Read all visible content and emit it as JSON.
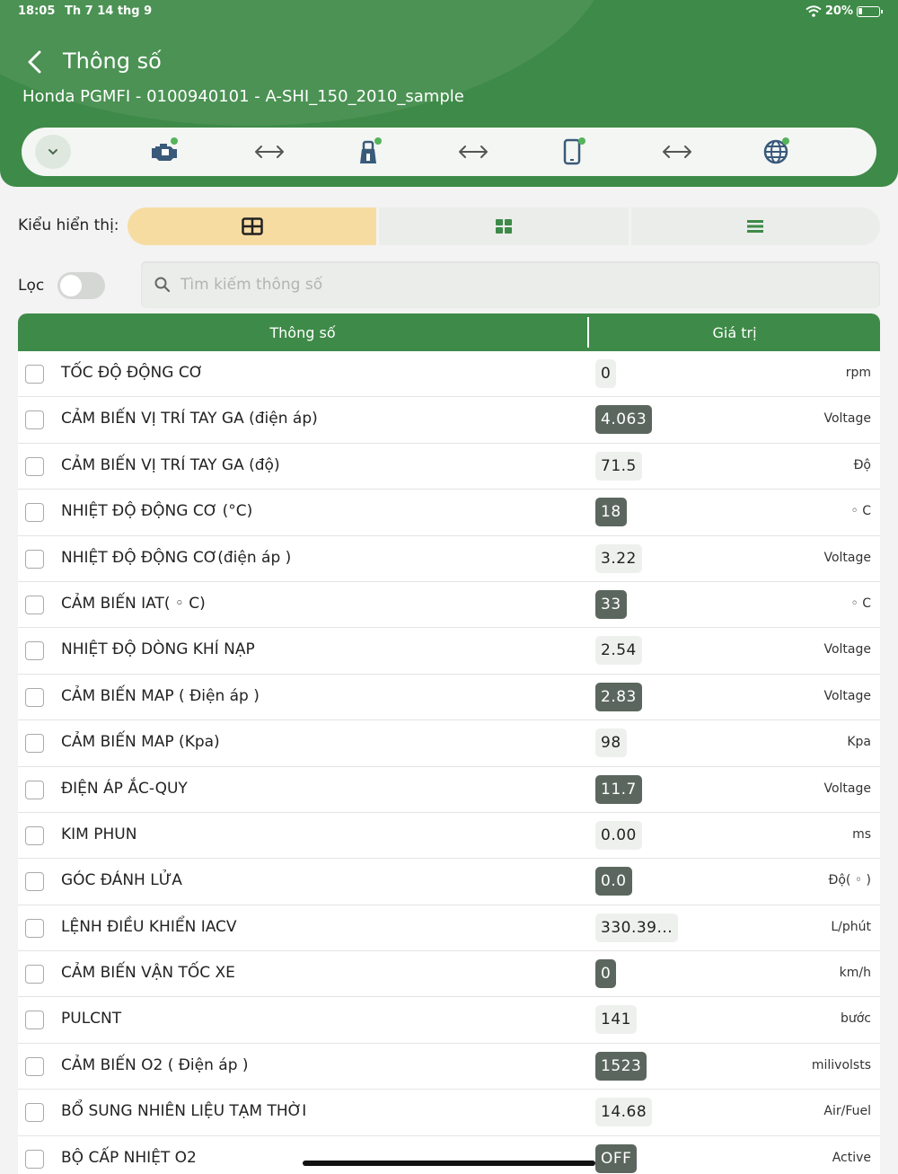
{
  "status": {
    "time": "18:05",
    "date": "Th 7 14 thg 9",
    "battery": "20%"
  },
  "header": {
    "title": "Thông số",
    "subtitle": "Honda PGMFI - 0100940101 - A-SHI_150_2010_sample"
  },
  "connection_icons": [
    "chevron-down-icon",
    "engine-icon",
    "left-right-arrow-icon",
    "obd-adapter-icon",
    "left-right-arrow-icon",
    "phone-icon",
    "left-right-arrow-icon",
    "globe-icon"
  ],
  "display": {
    "label": "Kiểu hiển thị:",
    "modes": [
      "table-icon",
      "grid-icon",
      "list-icon"
    ],
    "active": 0
  },
  "filter": {
    "label": "Lọc",
    "enabled": false
  },
  "search": {
    "placeholder": "Tìm kiếm thông số",
    "value": ""
  },
  "table": {
    "headers": {
      "param": "Thông số",
      "value": "Giá trị"
    },
    "rows": [
      {
        "name": "TỐC ĐỘ ĐỘNG CƠ",
        "value": "0",
        "unit": "rpm",
        "dark": false
      },
      {
        "name": "CẢM BIẾN  VỊ TRÍ TAY GA (điện áp)",
        "value": "4.063",
        "unit": "Voltage",
        "dark": true
      },
      {
        "name": "CẢM BIẾN  VỊ TRÍ TAY GA (độ)",
        "value": "71.5",
        "unit": "Độ",
        "dark": false
      },
      {
        "name": "NHIỆT ĐỘ ĐỘNG CƠ (°C)",
        "value": "18",
        "unit": "◦ C",
        "dark": true
      },
      {
        "name": "NHIỆT ĐỘ ĐỘNG CƠ(điện áp )",
        "value": "3.22",
        "unit": "Voltage",
        "dark": false
      },
      {
        "name": "CẢM BIẾN IAT(  ◦ C)",
        "value": "33",
        "unit": "◦ C",
        "dark": true
      },
      {
        "name": "NHIỆT ĐỘ DÒNG KHÍ NẠP",
        "value": "2.54",
        "unit": "Voltage",
        "dark": false
      },
      {
        "name": "CẢM BIẾN MAP ( Điện áp )",
        "value": "2.83",
        "unit": "Voltage",
        "dark": true
      },
      {
        "name": "CẢM BIẾN MAP (Kpa)",
        "value": "98",
        "unit": "Kpa",
        "dark": false
      },
      {
        "name": "ĐIỆN ÁP ẮC-QUY",
        "value": "11.7",
        "unit": "Voltage",
        "dark": true
      },
      {
        "name": "KIM PHUN",
        "value": "0.00",
        "unit": "ms",
        "dark": false
      },
      {
        "name": "GÓC ĐÁNH LỬA",
        "value": "0.0",
        "unit": "Độ( ◦ )",
        "dark": true
      },
      {
        "name": "LỆNH ĐIỀU KHIỂN IACV",
        "value": "330.39...",
        "unit": "L/phút",
        "dark": false
      },
      {
        "name": "CẢM BIẾN VẬN TỐC XE",
        "value": "0",
        "unit": "km/h",
        "dark": true
      },
      {
        "name": "PULCNT",
        "value": "141",
        "unit": "bước",
        "dark": false
      },
      {
        "name": "CẢM BIẾN O2 ( Điện áp )",
        "value": "1523",
        "unit": "milivolsts",
        "dark": true
      },
      {
        "name": "BỔ SUNG NHIÊN LIỆU TẠM THỜI",
        "value": "14.68",
        "unit": "Air/Fuel",
        "dark": false
      },
      {
        "name": "BỘ CẤP NHIỆT O2",
        "value": "OFF",
        "unit": "Active",
        "dark": true
      }
    ]
  }
}
